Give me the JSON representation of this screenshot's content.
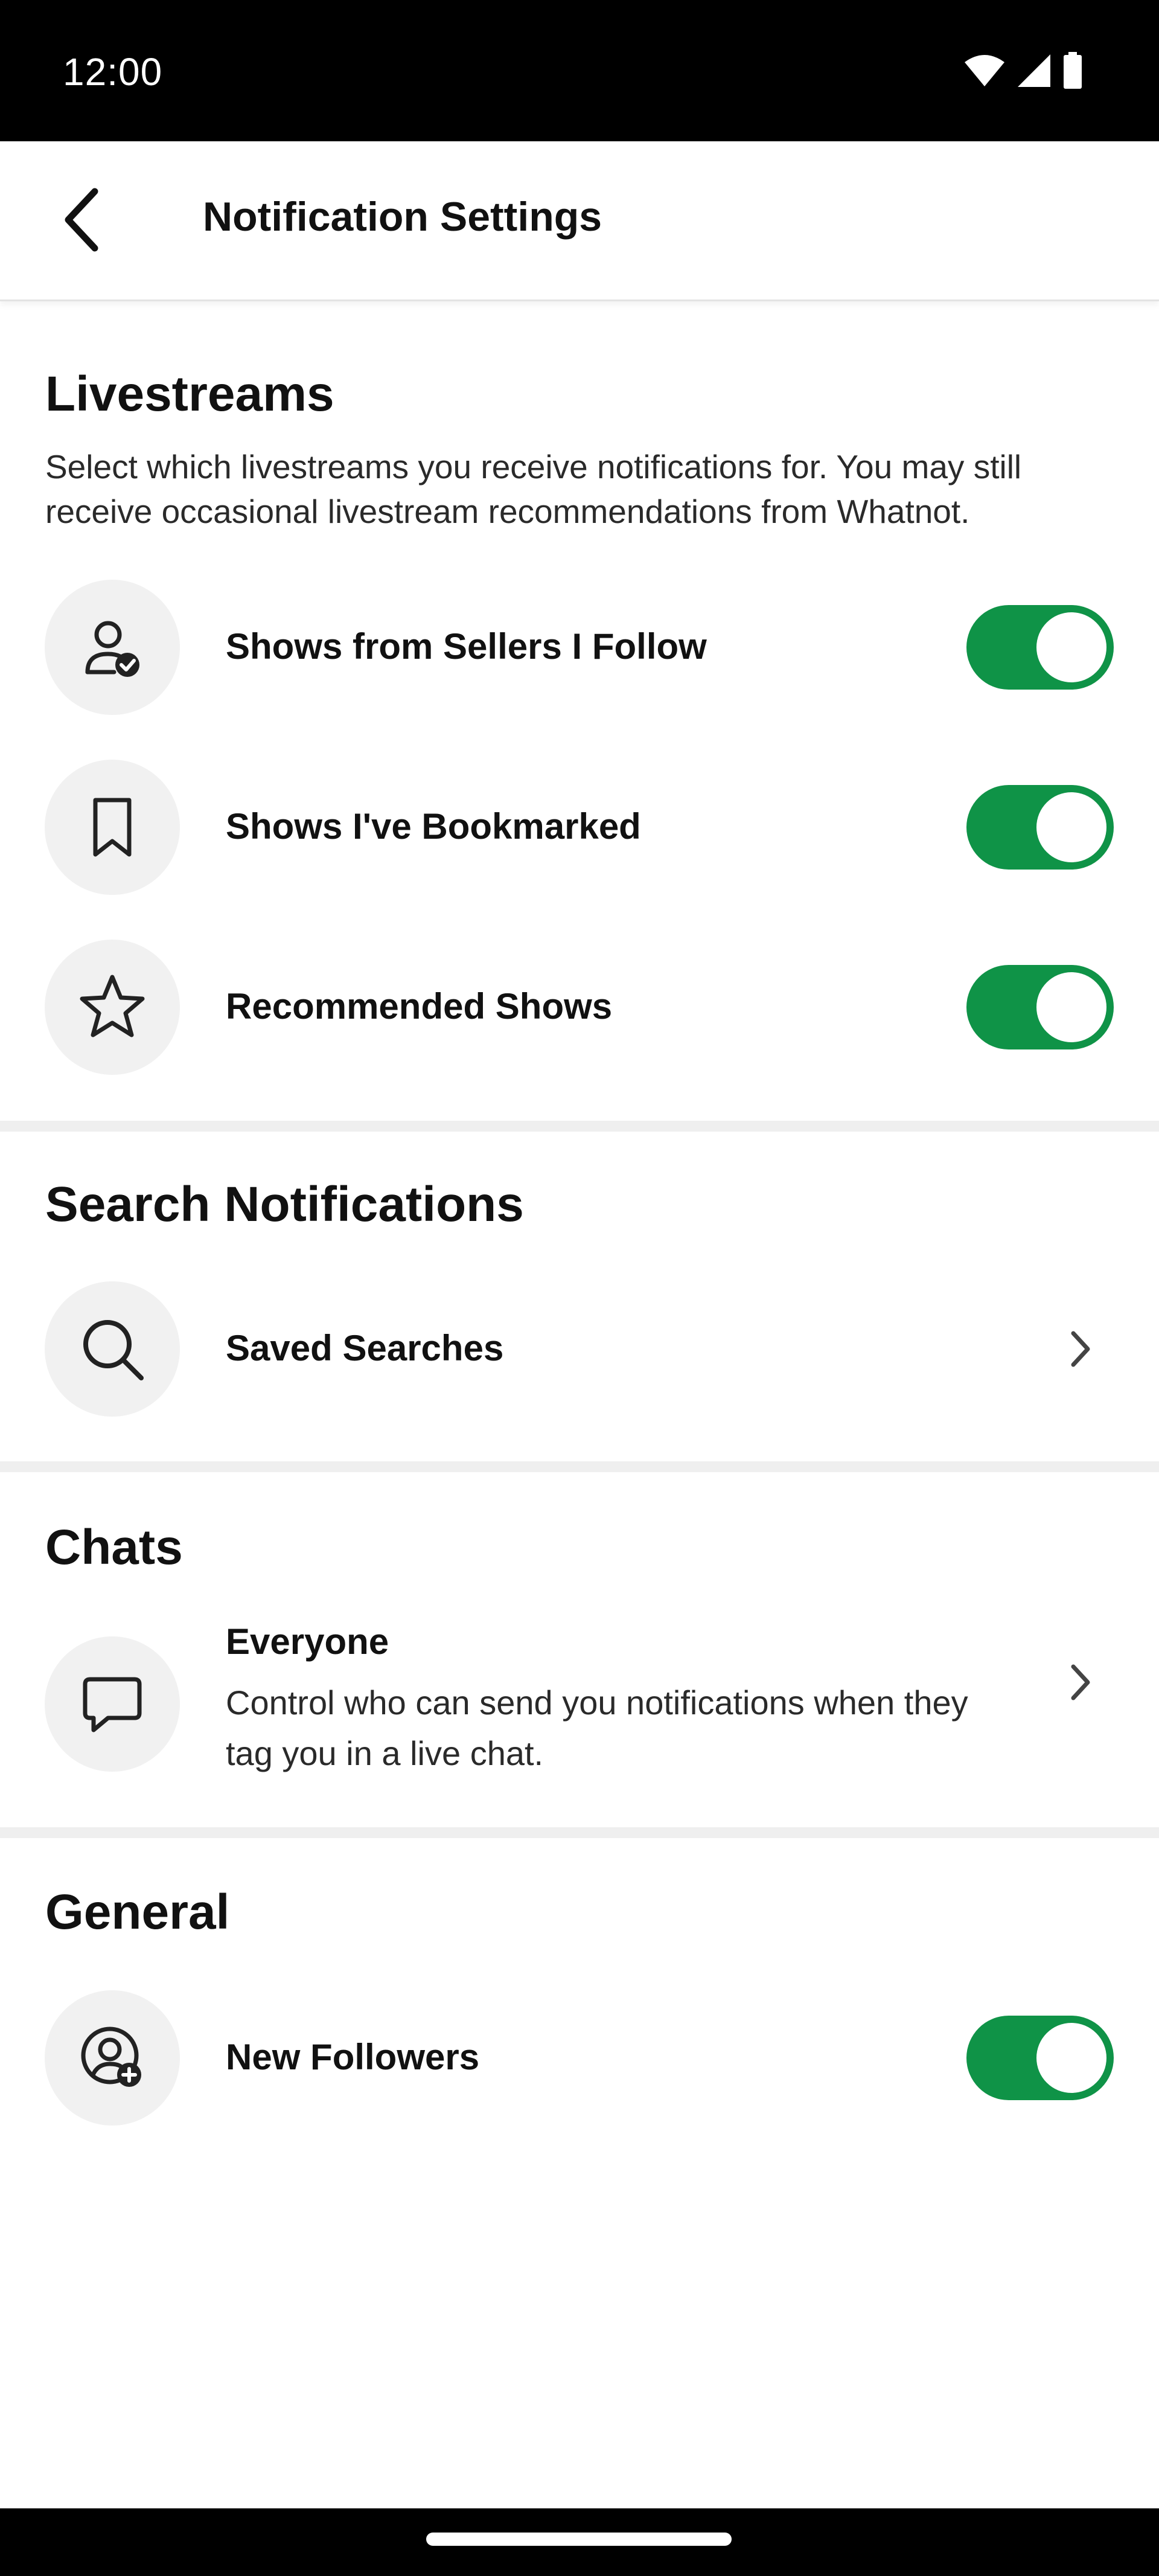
{
  "status_bar": {
    "time": "12:00",
    "icons": [
      "wifi-icon",
      "cell-signal-icon",
      "battery-icon"
    ]
  },
  "app_bar": {
    "title": "Notification Settings",
    "back_icon": "back-arrow-icon"
  },
  "livestreams": {
    "title": "Livestreams",
    "description": "Select which livestreams you receive notifications for. You may still receive occasional livestream recommendations from Whatnot.",
    "items": [
      {
        "label": "Shows from Sellers I Follow",
        "icon": "user-check-icon",
        "enabled": true
      },
      {
        "label": "Shows I've Bookmarked",
        "icon": "bookmark-icon",
        "enabled": true
      },
      {
        "label": "Recommended Shows",
        "icon": "star-icon",
        "enabled": true
      }
    ]
  },
  "search_notifications": {
    "title": "Search Notifications",
    "items": [
      {
        "label": "Saved Searches",
        "icon": "search-icon"
      }
    ]
  },
  "chats": {
    "title": "Chats",
    "items": [
      {
        "label": "Everyone",
        "description": "Control who can send you notifications when they tag you in a live chat.",
        "icon": "chat-bubble-icon"
      }
    ]
  },
  "general": {
    "title": "General",
    "items": [
      {
        "label": "New Followers",
        "icon": "user-plus-icon",
        "enabled": true
      }
    ]
  },
  "colors": {
    "toggle_on": "#0f9347",
    "icon_bg": "#f1f1f1",
    "divider": "#efefef"
  }
}
